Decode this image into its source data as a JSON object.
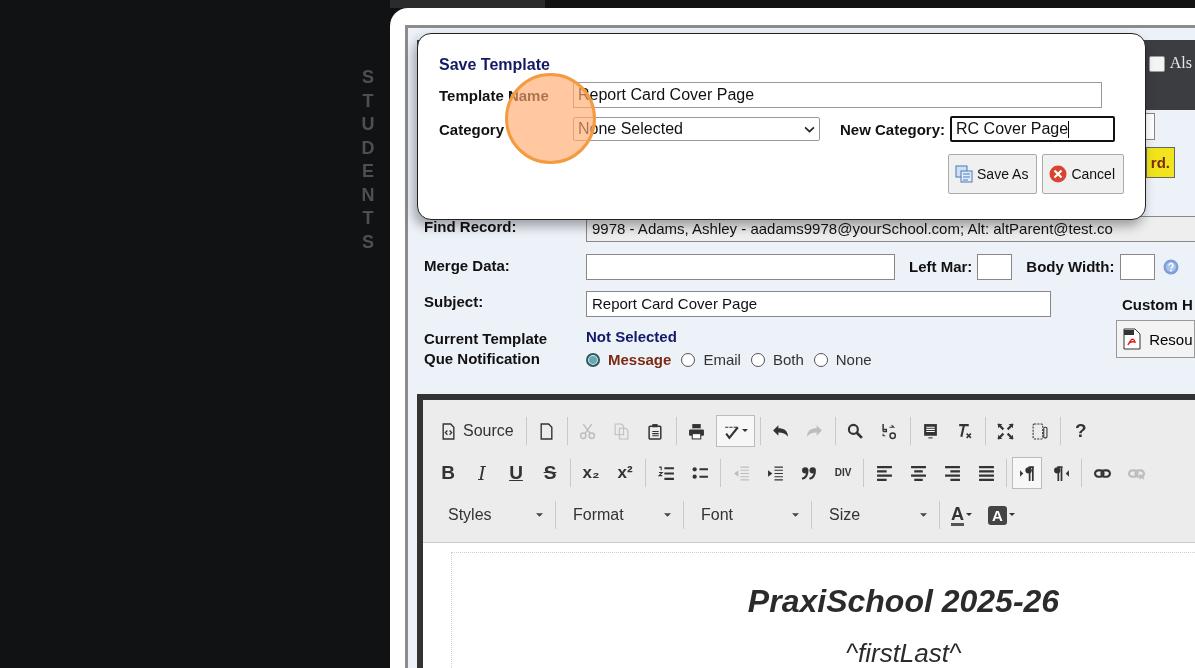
{
  "sidebar": {
    "vertical_label": "STUDENTS"
  },
  "header": {
    "checkbox": {
      "label": "Als",
      "checked": false
    },
    "badge": "rd."
  },
  "form": {
    "find_record": {
      "label": "Find Record:",
      "value": "9978 - Adams, Ashley - aadams9978@yourSchool.com; Alt: altParent@test.co"
    },
    "merge_data": {
      "label": "Merge Data:"
    },
    "left_margin": {
      "label": "Left Mar:"
    },
    "body_width": {
      "label": "Body Width:"
    },
    "subject": {
      "label": "Subject:",
      "value": "Report Card Cover Page"
    },
    "custom_header": {
      "label": "Custom H"
    },
    "resource_button": {
      "label": "Resou"
    },
    "current_template": {
      "label": "Current Template",
      "value": "Not Selected"
    },
    "notification": {
      "label": "Que Notification",
      "options": [
        {
          "label": "Message",
          "selected": true
        },
        {
          "label": "Email",
          "selected": false
        },
        {
          "label": "Both",
          "selected": false
        },
        {
          "label": "None",
          "selected": false
        }
      ]
    }
  },
  "editor": {
    "toolbar_rows": [
      [
        [
          {
            "kind": "labeled",
            "label": "Source",
            "disabled": false,
            "selected": false
          }
        ],
        [
          {
            "kind": "icon",
            "disabled": false,
            "selected": false
          }
        ],
        [
          {
            "kind": "icon",
            "disabled": true,
            "selected": false
          },
          {
            "kind": "icon",
            "disabled": true,
            "selected": false
          },
          {
            "kind": "icon",
            "disabled": false,
            "selected": false
          }
        ],
        [
          {
            "kind": "icon",
            "disabled": false,
            "selected": false
          },
          {
            "kind": "icon",
            "disabled": false,
            "selected": true
          }
        ],
        [
          {
            "kind": "icon",
            "disabled": false,
            "selected": false
          },
          {
            "kind": "icon",
            "disabled": true,
            "selected": false
          }
        ],
        [
          {
            "kind": "icon",
            "disabled": false,
            "selected": false
          },
          {
            "kind": "icon",
            "disabled": false,
            "selected": false
          }
        ],
        [
          {
            "kind": "icon",
            "disabled": false,
            "selected": false
          },
          {
            "kind": "icon",
            "disabled": false,
            "selected": false
          }
        ],
        [
          {
            "kind": "icon",
            "disabled": false,
            "selected": false
          },
          {
            "kind": "icon",
            "disabled": false,
            "selected": false
          }
        ],
        [
          {
            "kind": "glyph",
            "glyph": "?",
            "disabled": false,
            "selected": false
          }
        ]
      ],
      [
        [
          {
            "kind": "glyph",
            "glyph": "B",
            "disabled": false,
            "selected": false
          },
          {
            "kind": "glyph",
            "glyph": "I",
            "disabled": false,
            "selected": false
          },
          {
            "kind": "glyph",
            "glyph": "U",
            "disabled": false,
            "selected": false
          },
          {
            "kind": "glyph",
            "glyph": "S",
            "disabled": false,
            "selected": false
          }
        ],
        [
          {
            "kind": "glyph",
            "glyph": "x₂",
            "disabled": false,
            "selected": false
          },
          {
            "kind": "glyph",
            "glyph": "x²",
            "disabled": false,
            "selected": false
          }
        ],
        [
          {
            "kind": "icon",
            "disabled": false,
            "selected": false
          },
          {
            "kind": "icon",
            "disabled": false,
            "selected": false
          }
        ],
        [
          {
            "kind": "icon",
            "disabled": true,
            "selected": false
          },
          {
            "kind": "icon",
            "disabled": false,
            "selected": false
          },
          {
            "kind": "icon",
            "disabled": false,
            "selected": false
          },
          {
            "kind": "glyph",
            "glyph": "DIV",
            "disabled": false,
            "selected": false
          }
        ],
        [
          {
            "kind": "icon",
            "disabled": false,
            "selected": false
          },
          {
            "kind": "icon",
            "disabled": false,
            "selected": false
          },
          {
            "kind": "icon",
            "disabled": false,
            "selected": false
          },
          {
            "kind": "icon",
            "disabled": false,
            "selected": false
          }
        ],
        [
          {
            "kind": "icon",
            "disabled": false,
            "selected": true
          },
          {
            "kind": "icon",
            "disabled": false,
            "selected": false
          }
        ],
        [
          {
            "kind": "icon",
            "disabled": false,
            "selected": false
          },
          {
            "kind": "icon",
            "disabled": true,
            "selected": false
          }
        ]
      ]
    ],
    "dropdowns": [
      "Styles",
      "Format",
      "Font",
      "Size"
    ],
    "color_buttons": [
      {
        "kind": "text-color",
        "glyph": "A"
      },
      {
        "kind": "background-color",
        "glyph": "A"
      }
    ],
    "content": {
      "title": "PraxiSchool 2025-26",
      "line": "^firstLast^"
    }
  },
  "dialog": {
    "title": "Save Template",
    "name_label": "Template Name",
    "name_value": "Report Card Cover Page",
    "category_label": "Category",
    "category_value": "None Selected",
    "new_category_label": "New Category:",
    "new_category_value": "RC Cover Page",
    "buttons": [
      {
        "kind": "save",
        "label": "Save As"
      },
      {
        "kind": "cancel",
        "label": "Cancel"
      }
    ]
  }
}
